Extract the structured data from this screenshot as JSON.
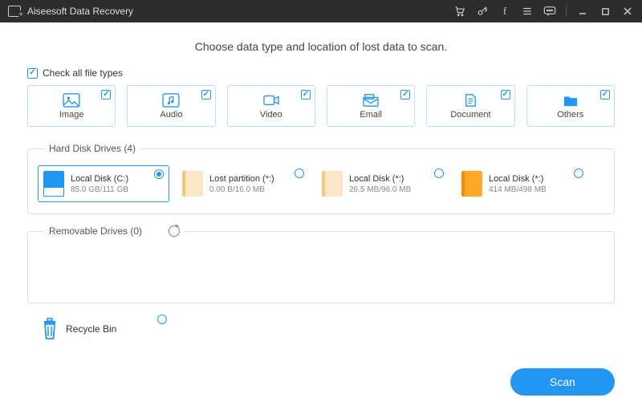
{
  "titlebar": {
    "app_name": "Aiseesoft Data Recovery",
    "icons": [
      "cart",
      "key",
      "facebook",
      "menu",
      "feedback",
      "minimize",
      "maximize",
      "close"
    ]
  },
  "instruction": "Choose data type and location of lost data to scan.",
  "check_all_label": "Check all file types",
  "check_all_checked": true,
  "types": [
    {
      "id": "image",
      "label": "Image",
      "checked": true
    },
    {
      "id": "audio",
      "label": "Audio",
      "checked": true
    },
    {
      "id": "video",
      "label": "Video",
      "checked": true
    },
    {
      "id": "email",
      "label": "Email",
      "checked": true
    },
    {
      "id": "document",
      "label": "Document",
      "checked": true
    },
    {
      "id": "others",
      "label": "Others",
      "checked": true
    }
  ],
  "hdd": {
    "legend": "Hard Disk Drives (4)",
    "drives": [
      {
        "name": "Local Disk (C:)",
        "size": "85.0 GB/111 GB",
        "selected": true,
        "color": "blue"
      },
      {
        "name": "Lost partition (*:)",
        "size": "0.00  B/16.0 MB",
        "selected": false,
        "color": "cream"
      },
      {
        "name": "Local Disk (*:)",
        "size": "26.5 MB/96.0 MB",
        "selected": false,
        "color": "cream"
      },
      {
        "name": "Local Disk (*:)",
        "size": "414 MB/498 MB",
        "selected": false,
        "color": "orange"
      }
    ]
  },
  "removable": {
    "legend": "Removable Drives (0)"
  },
  "recycle": {
    "label": "Recycle Bin",
    "selected": false
  },
  "scan_label": "Scan"
}
